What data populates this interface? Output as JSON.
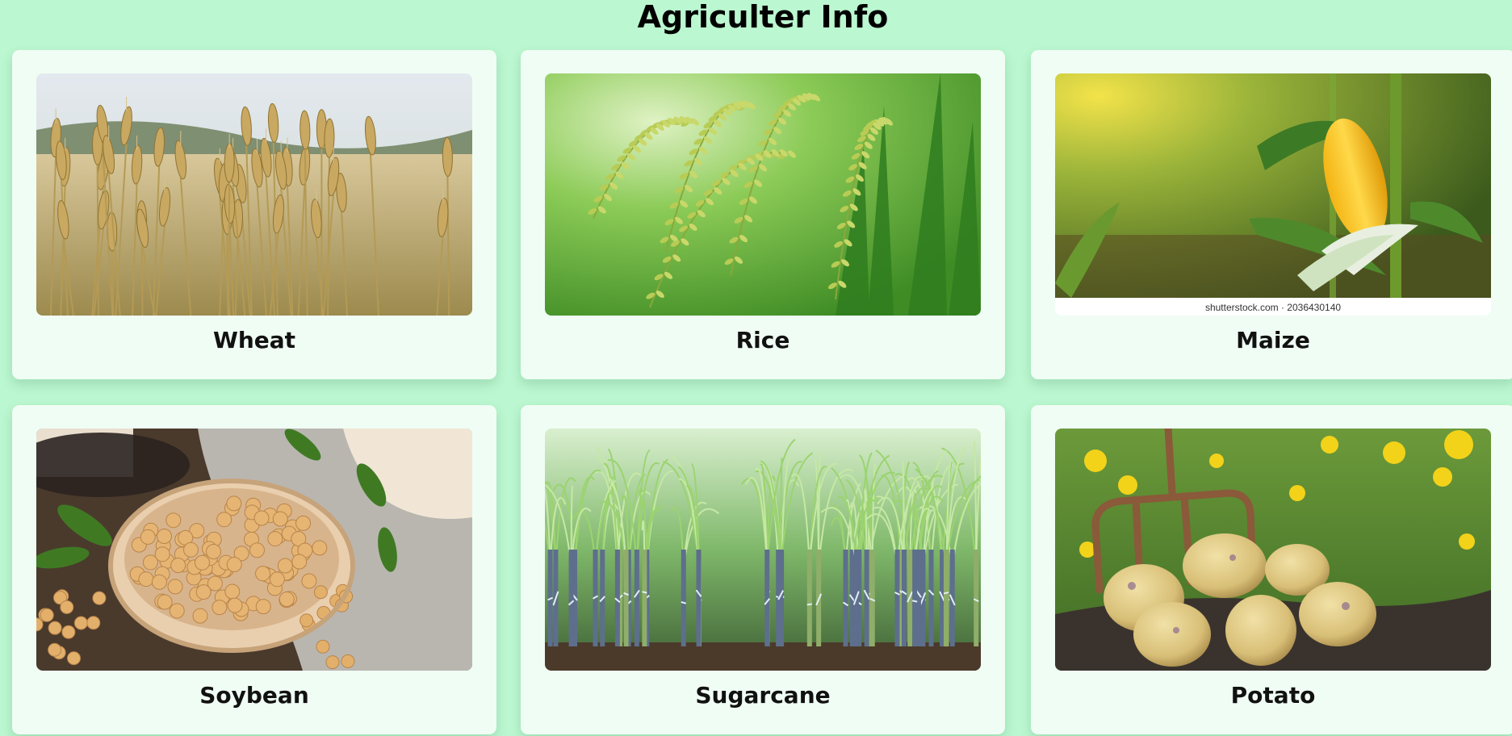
{
  "header": {
    "title": "Agriculter Info"
  },
  "crops": [
    {
      "label": "Wheat",
      "image": "wheat-field"
    },
    {
      "label": "Rice",
      "image": "rice-panicles"
    },
    {
      "label": "Maize",
      "image": "maize-cob",
      "caption": "shutterstock.com · 2036430140"
    },
    {
      "label": "Soybean",
      "image": "soybeans-basket"
    },
    {
      "label": "Sugarcane",
      "image": "sugarcane-field"
    },
    {
      "label": "Potato",
      "image": "potatoes-with-fork"
    }
  ]
}
